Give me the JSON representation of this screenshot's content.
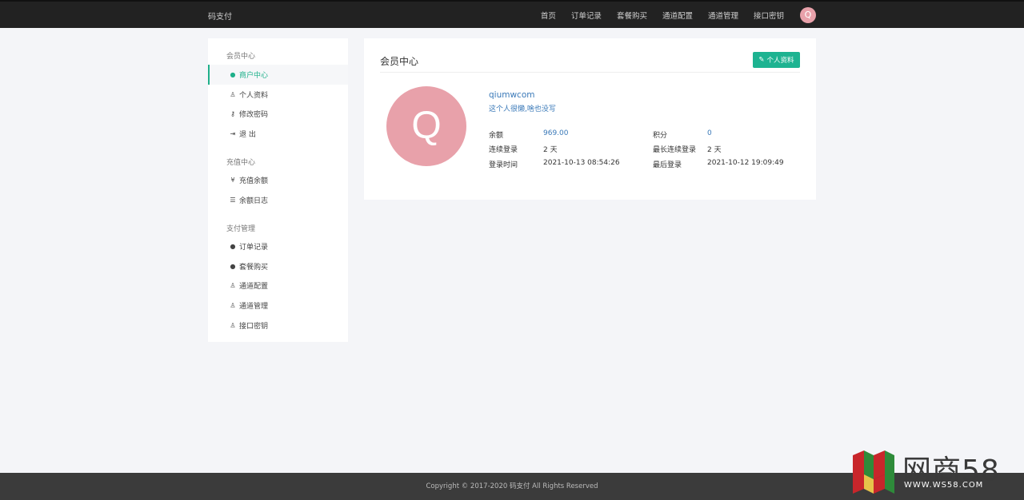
{
  "topbar": {
    "brand": "码支付",
    "nav": [
      "首页",
      "订单记录",
      "套餐购买",
      "通道配置",
      "通道管理",
      "接口密钥"
    ],
    "avatar_letter": "Q"
  },
  "sidebar": {
    "groups": [
      {
        "title": "会员中心",
        "items": [
          {
            "label": "商户中心",
            "icon": "user-circle-icon",
            "active": true
          },
          {
            "label": "个人资料",
            "icon": "user-icon"
          },
          {
            "label": "修改密码",
            "icon": "key-icon"
          },
          {
            "label": "退 出",
            "icon": "sign-out-icon"
          }
        ]
      },
      {
        "title": "充值中心",
        "items": [
          {
            "label": "充值余额",
            "icon": "yen-icon"
          },
          {
            "label": "余额日志",
            "icon": "list-icon"
          }
        ]
      },
      {
        "title": "支付管理",
        "items": [
          {
            "label": "订单记录",
            "icon": "user-circle-icon"
          },
          {
            "label": "套餐购买",
            "icon": "user-circle-icon"
          },
          {
            "label": "通道配置",
            "icon": "user-icon"
          },
          {
            "label": "通道管理",
            "icon": "user-icon"
          },
          {
            "label": "接口密钥",
            "icon": "user-icon"
          }
        ]
      }
    ]
  },
  "panel": {
    "title": "会员中心",
    "button_label": "个人资料",
    "avatar_letter": "Q",
    "username": "qiumwcom",
    "bio": "这个人很懒,啥也没写",
    "stats": {
      "balance_label": "余额",
      "balance": "969.00",
      "points_label": "积分",
      "points": "0",
      "streak_label": "连续登录",
      "streak": "2 天",
      "longest_label": "最长连续登录",
      "longest": "2 天",
      "login_time_label": "登录时间",
      "login_time": "2021-10-13 08:54:26",
      "last_login_label": "最后登录",
      "last_login": "2021-10-12 19:09:49"
    }
  },
  "footer": {
    "text": "Copyright © 2017-2020 码支付 All Rights Reserved"
  },
  "watermark": {
    "text": "网商58",
    "url": "WWW.WS58.COM"
  },
  "colors": {
    "accent": "#1db391",
    "avatar": "#e8a1aa",
    "link": "#3a79b8"
  }
}
